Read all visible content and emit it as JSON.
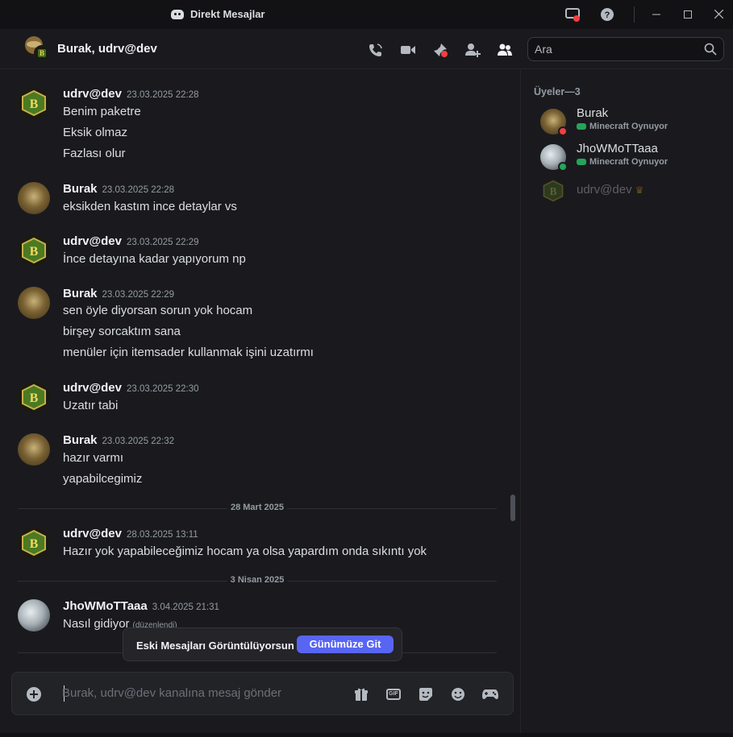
{
  "app": {
    "title": "Direkt Mesajlar"
  },
  "header": {
    "title": "Burak, udrv@dev",
    "search_placeholder": "Ara"
  },
  "messages": [
    {
      "author": "udrv@dev",
      "time": "23.03.2025 22:28",
      "lines": [
        "Benim paketre",
        "Eksik olmaz",
        "Fazlası olur"
      ]
    },
    {
      "author": "Burak",
      "time": "23.03.2025 22:28",
      "lines": [
        "eksikden kastım ince detaylar vs"
      ]
    },
    {
      "author": "udrv@dev",
      "time": "23.03.2025 22:29",
      "lines": [
        "İnce detayına kadar yapıyorum np"
      ]
    },
    {
      "author": "Burak",
      "time": "23.03.2025 22:29",
      "lines": [
        "sen öyle diyorsan sorun yok hocam",
        "birşey sorcaktım sana",
        "menüler için itemsader kullanmak işini uzatırmı"
      ]
    },
    {
      "author": "udrv@dev",
      "time": "23.03.2025 22:30",
      "lines": [
        "Uzatır tabi"
      ]
    },
    {
      "author": "Burak",
      "time": "23.03.2025 22:32",
      "lines": [
        "hazır varmı",
        "yapabilcegimiz"
      ]
    },
    {
      "author": "udrv@dev",
      "time": "28.03.2025 13:11",
      "lines": [
        "Hazır yok yapabileceğimiz hocam ya olsa yapardım onda sıkıntı yok"
      ]
    },
    {
      "author": "JhoWMoTTaaa",
      "time": "3.04.2025 21:31",
      "lines": [
        "Nasıl gidiyor"
      ],
      "edited": "(düzenlendi)"
    }
  ],
  "dividers": [
    "28 Mart 2025",
    "3 Nisan 2025"
  ],
  "jump_bar": {
    "text": "Eski Mesajları Görüntülüyorsun",
    "button": "Günümüze Git"
  },
  "composer": {
    "placeholder": "Burak, udrv@dev kanalına mesaj gönder"
  },
  "members": {
    "heading": "Üyeler—3",
    "list": [
      {
        "name": "Burak",
        "activity": "Minecraft Oynuyor",
        "status": "dnd"
      },
      {
        "name": "JhoWMoTTaaa",
        "activity": "Minecraft Oynuyor",
        "status": "online"
      },
      {
        "name": "udrv@dev",
        "activity": "",
        "status": "offline"
      }
    ]
  },
  "colors": {
    "accent": "#5865f2",
    "online": "#23a55a",
    "dnd": "#f23f43",
    "background": "#1a1a1e"
  }
}
